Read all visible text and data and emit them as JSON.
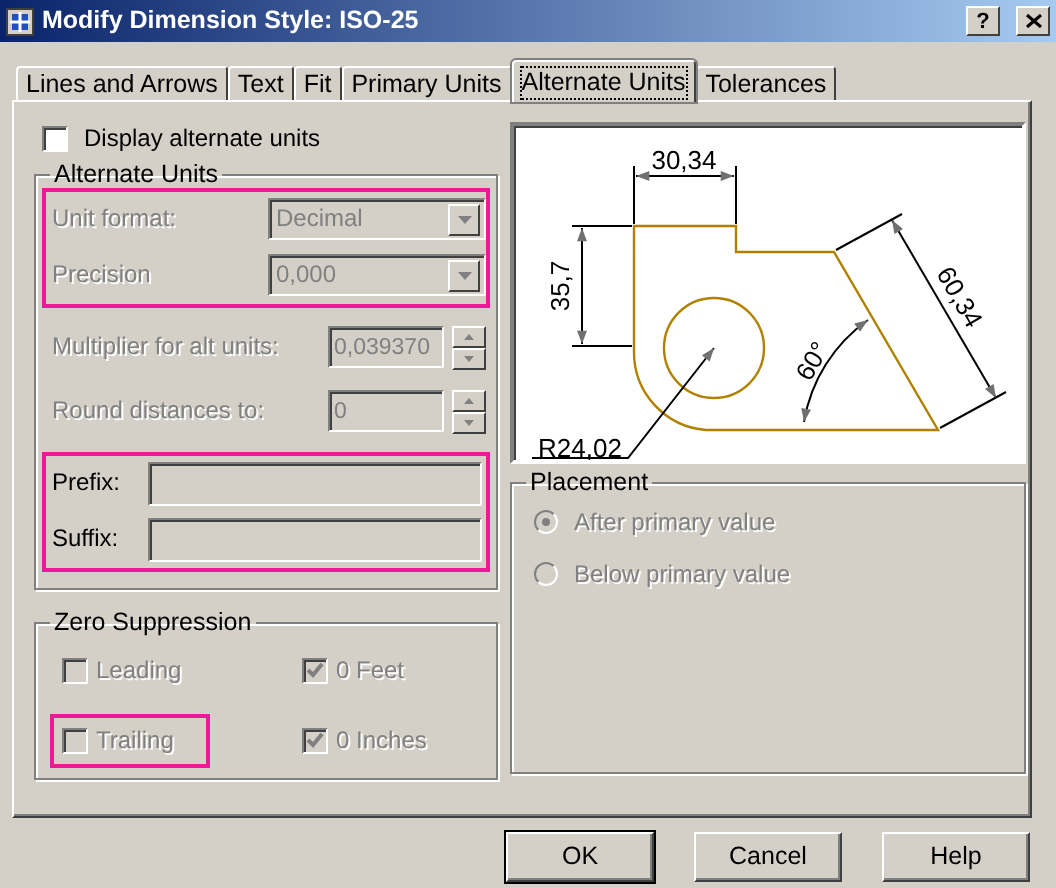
{
  "window": {
    "title": "Modify Dimension Style: ISO-25",
    "help_button": "?"
  },
  "tabs": [
    {
      "label": "Lines and Arrows",
      "selected": false
    },
    {
      "label": "Text",
      "selected": false
    },
    {
      "label": "Fit",
      "selected": false
    },
    {
      "label": "Primary Units",
      "selected": false
    },
    {
      "label": "Alternate Units",
      "selected": true
    },
    {
      "label": "Tolerances",
      "selected": false
    }
  ],
  "display_alternate_units": {
    "label": "Display alternate units",
    "checked": false
  },
  "alternate_units": {
    "title": "Alternate Units",
    "groups": [
      {
        "highlighted": true,
        "rows": [
          {
            "kind": "dropdown",
            "label": "Unit format:",
            "value": "Decimal",
            "disabled": true
          },
          {
            "kind": "dropdown",
            "label": "Precision",
            "value": "0,000",
            "disabled": true
          }
        ]
      },
      {
        "rows": [
          {
            "kind": "spinner",
            "label": "Multiplier for alt units:",
            "value": "0,039370",
            "disabled": true
          },
          {
            "kind": "spinner",
            "label": "Round distances  to:",
            "value": "0",
            "disabled": true
          }
        ]
      },
      {
        "highlighted": true,
        "rows": [
          {
            "kind": "text",
            "label": "Prefix:"
          },
          {
            "kind": "text",
            "label": "Suffix:"
          }
        ]
      }
    ]
  },
  "zero_suppression": {
    "title": "Zero Suppression",
    "options": [
      {
        "label": "Leading",
        "checked": false,
        "disabled": true
      },
      {
        "label": "0 Feet",
        "checked": true,
        "disabled": true
      },
      {
        "label": "Trailing",
        "checked": false,
        "disabled": true,
        "highlighted": true
      },
      {
        "label": "0 Inches",
        "checked": true,
        "disabled": true
      }
    ]
  },
  "preview": {
    "width_dimension": "30,34",
    "height_dimension": "35,7",
    "aligned_dimension": "60,34",
    "angle_dimension": "60°",
    "radius_dimension": "R24,02"
  },
  "placement": {
    "title": "Placement",
    "options": [
      {
        "label": "After primary value",
        "selected": true,
        "disabled": true
      },
      {
        "label": "Below primary value",
        "selected": false,
        "disabled": true
      }
    ]
  },
  "buttons": [
    {
      "label": "OK",
      "default": true
    },
    {
      "label": "Cancel",
      "default": false
    },
    {
      "label": "Help",
      "default": false
    }
  ]
}
